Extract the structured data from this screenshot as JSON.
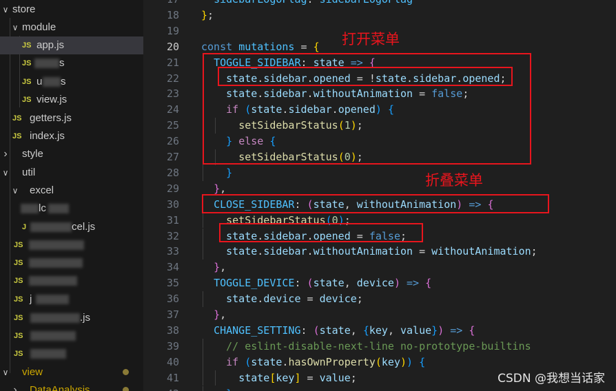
{
  "explorer": {
    "items": [
      {
        "label": "store",
        "chevron": "∨"
      },
      {
        "label": "module",
        "chevron": "∨"
      },
      {
        "label": "app.js",
        "badge": "JS"
      },
      {
        "label": "s",
        "badge": "JS"
      },
      {
        "label": "s",
        "badge": "JS",
        "prefix": "u"
      },
      {
        "label": "view.js",
        "badge": "JS"
      },
      {
        "label": "getters.js",
        "badge": "JS"
      },
      {
        "label": "index.js",
        "badge": "JS"
      },
      {
        "label": "style",
        "chevron": "›"
      },
      {
        "label": "util",
        "chevron": "∨"
      },
      {
        "label": "excel",
        "chevron": "∨"
      },
      {
        "label": "lc",
        "badge": ""
      },
      {
        "label": "cel.js",
        "badge": "J"
      },
      {
        "label": "",
        "badge": "JS"
      },
      {
        "label": "",
        "badge": "JS"
      },
      {
        "label": "",
        "badge": "JS"
      },
      {
        "label": "j",
        "badge": "JS"
      },
      {
        "label": ".js",
        "badge": "JS"
      },
      {
        "label": "",
        "badge": "JS"
      },
      {
        "label": "",
        "badge": "JS"
      },
      {
        "label": "view",
        "chevron": "∨"
      },
      {
        "label": "DataAnalysis",
        "chevron": "›"
      }
    ]
  },
  "editor": {
    "active_line": "20",
    "lines": [
      {
        "n": "17",
        "t": "  sidebarLogoFlag: sidebarLogoFlag"
      },
      {
        "n": "18",
        "t": "};"
      },
      {
        "n": "19",
        "t": ""
      },
      {
        "n": "20",
        "t": "const mutations = {"
      },
      {
        "n": "21",
        "t": "  TOGGLE_SIDEBAR: state => {"
      },
      {
        "n": "22",
        "t": "    state.sidebar.opened = !state.sidebar.opened;"
      },
      {
        "n": "23",
        "t": "    state.sidebar.withoutAnimation = false;"
      },
      {
        "n": "24",
        "t": "    if (state.sidebar.opened) {"
      },
      {
        "n": "25",
        "t": "      setSidebarStatus(1);"
      },
      {
        "n": "26",
        "t": "    } else {"
      },
      {
        "n": "27",
        "t": "      setSidebarStatus(0);"
      },
      {
        "n": "28",
        "t": "    }"
      },
      {
        "n": "29",
        "t": "  },"
      },
      {
        "n": "30",
        "t": "  CLOSE_SIDEBAR: (state, withoutAnimation) => {"
      },
      {
        "n": "31",
        "t": "    setSidebarStatus(0);"
      },
      {
        "n": "32",
        "t": "    state.sidebar.opened = false;"
      },
      {
        "n": "33",
        "t": "    state.sidebar.withoutAnimation = withoutAnimation;"
      },
      {
        "n": "34",
        "t": "  },"
      },
      {
        "n": "35",
        "t": "  TOGGLE_DEVICE: (state, device) => {"
      },
      {
        "n": "36",
        "t": "    state.device = device;"
      },
      {
        "n": "37",
        "t": "  },"
      },
      {
        "n": "38",
        "t": "  CHANGE_SETTING: (state, {key, value}) => {"
      },
      {
        "n": "39",
        "t": "    // eslint-disable-next-line no-prototype-builtins"
      },
      {
        "n": "40",
        "t": "    if (state.hasOwnProperty(key)) {"
      },
      {
        "n": "41",
        "t": "      state[key] = value;"
      },
      {
        "n": "42",
        "t": "    }"
      }
    ]
  },
  "annotations": {
    "open_menu": "打开菜单",
    "collapse_menu": "折叠菜单"
  },
  "watermark": "CSDN @我想当话家",
  "colors": {
    "annotation": "#e8151d",
    "background": "#1f1f1f",
    "sidebar": "#181818",
    "js_badge": "#cbcb41"
  }
}
